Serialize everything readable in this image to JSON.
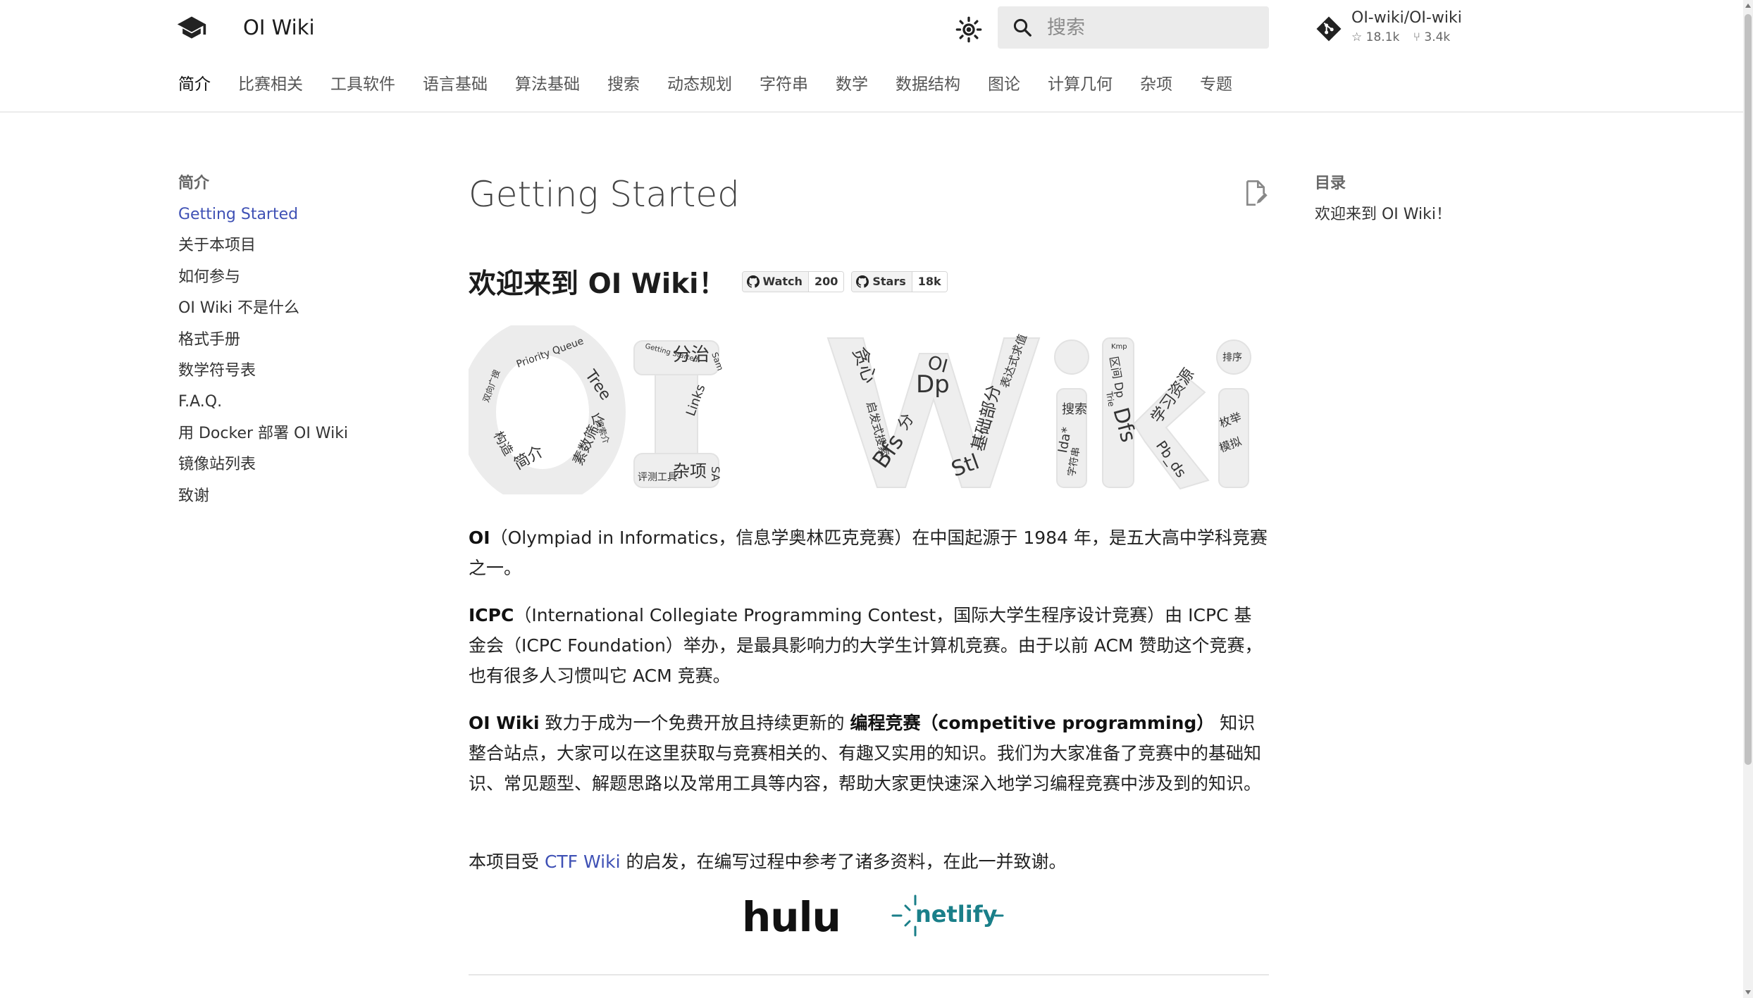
{
  "header": {
    "site_title": "OI Wiki",
    "search_placeholder": "搜索",
    "repo_name": "OI-wiki/OI-wiki",
    "stars": "18.1k",
    "forks": "3.4k"
  },
  "tabs": [
    "简介",
    "比赛相关",
    "工具软件",
    "语言基础",
    "算法基础",
    "搜索",
    "动态规划",
    "字符串",
    "数学",
    "数据结构",
    "图论",
    "计算几何",
    "杂项",
    "专题"
  ],
  "nav": {
    "title": "简介",
    "items": [
      "Getting Started",
      "关于本项目",
      "如何参与",
      "OI Wiki 不是什么",
      "格式手册",
      "数学符号表",
      "F.A.Q.",
      "用 Docker 部署 OI Wiki",
      "镜像站列表",
      "致谢"
    ]
  },
  "toc": {
    "title": "目录",
    "items": [
      "欢迎来到 OI Wiki！"
    ]
  },
  "main": {
    "title": "Getting Started",
    "welcome_prefix": "欢迎来到 ",
    "welcome_bold": "OI Wiki",
    "welcome_suffix": "！",
    "badge_watch_label": "Watch",
    "badge_watch_count": "200",
    "badge_stars_label": "Stars",
    "badge_stars_count": "18k",
    "p1_bold": "OI",
    "p1_text": "（Olympiad in Informatics，信息学奥林匹克竞赛）在中国起源于 1984 年，是五大高中学科竞赛之一。",
    "p2_bold": "ICPC",
    "p2_text": "（International Collegiate Programming Contest，国际大学生程序设计竞赛）由 ICPC 基金会（ICPC Foundation）举办，是最具影响力的大学生计算机竞赛。由于以前 ACM 赞助这个竞赛，也有很多人习惯叫它 ACM 竞赛。",
    "p3_bold1": "OI Wiki",
    "p3_text1": " 致力于成为一个免费开放且持续更新的 ",
    "p3_bold2": "编程竞赛（competitive programming）",
    "p3_text2": " 知识整合站点，大家可以在这里获取与竞赛相关的、有趣又实用的知识。我们为大家准备了竞赛中的基础知识、常见题型、解题思路以及常用工具等内容，帮助大家更快速深入地学习编程竞赛中涉及到的知识。",
    "p4_text1": "本项目受 ",
    "p4_link": "CTF Wiki",
    "p4_text2": " 的启发，在编写过程中参考了诸多资料，在此一并致谢。",
    "sponsor1": "hulu",
    "sponsor2": "netlify"
  },
  "wordcloud_words": {
    "o": [
      "Priority Queue",
      "Tree",
      "简介",
      "素数筛介",
      "构造",
      "Links",
      "搜索介",
      "双向广搜"
    ],
    "i": [
      "分治",
      "Sam",
      "杂项",
      "评测工具",
      "SA",
      "Getting Started"
    ],
    "w": [
      "贪心",
      "Dp",
      "OI",
      "Bfs",
      "Stl",
      "基础部分",
      "分",
      "启发式搜索",
      "表达式求值"
    ],
    "i2": [
      "搜索",
      "Ida*",
      "字符串"
    ],
    "k": [
      "Dfs",
      "区间 Dp",
      "学习资源",
      "Pb_ds",
      "Trie",
      "Kmp"
    ],
    "i3": [
      "排序",
      "枚举",
      "模拟"
    ]
  },
  "colors": {
    "accent": "#3f51b5",
    "netlify": "#1a7f89"
  }
}
